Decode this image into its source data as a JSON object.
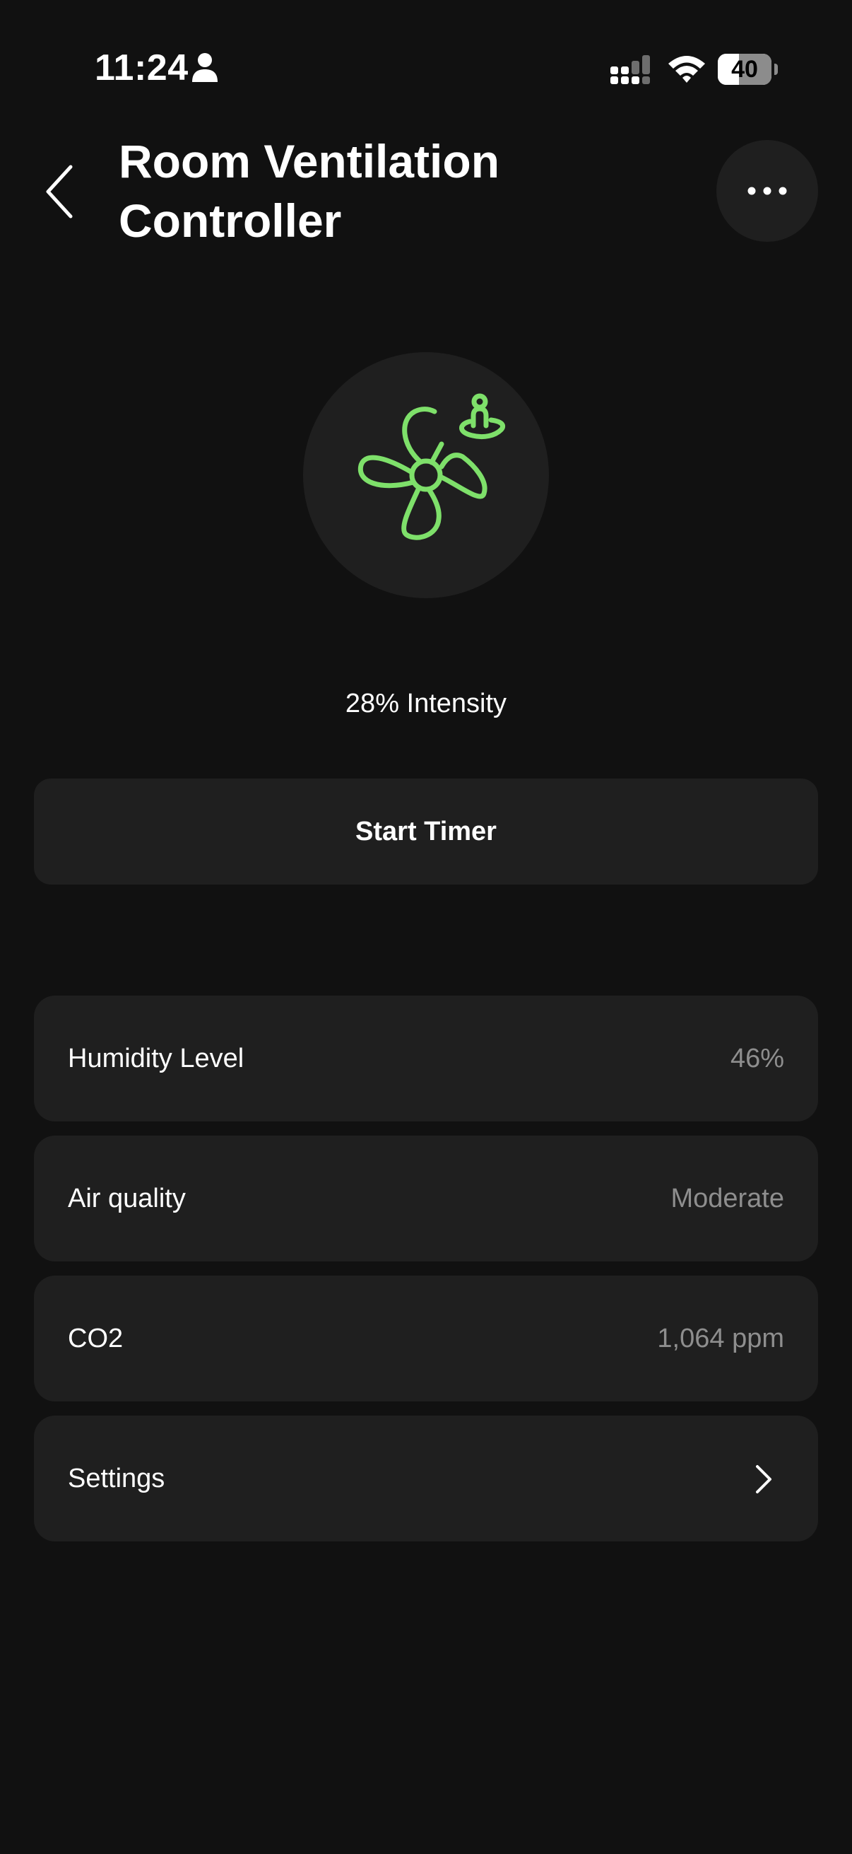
{
  "status_bar": {
    "time": "11:24",
    "battery_level": "40",
    "battery_fraction": 0.4,
    "icons": [
      "person-icon",
      "cellular-signal-icon",
      "wifi-icon",
      "battery-icon"
    ]
  },
  "header": {
    "title": "Room Ventilation Controller",
    "back_icon": "chevron-left-icon",
    "more_icon": "ellipsis-icon"
  },
  "fan": {
    "icon": "fan-presence-icon",
    "accent_color": "#7ee06a",
    "intensity_label": "28% Intensity"
  },
  "timer": {
    "label": "Start Timer"
  },
  "rows": [
    {
      "label": "Humidity Level",
      "value": "46%"
    },
    {
      "label": "Air quality",
      "value": "Moderate"
    },
    {
      "label": "CO2",
      "value": "1,064 ppm"
    },
    {
      "label": "Settings",
      "icon": "chevron-right-icon"
    }
  ],
  "colors": {
    "background": "#111111",
    "card": "#1f1f1f",
    "secondary_text": "#8e8e8e",
    "accent": "#7ee06a"
  }
}
